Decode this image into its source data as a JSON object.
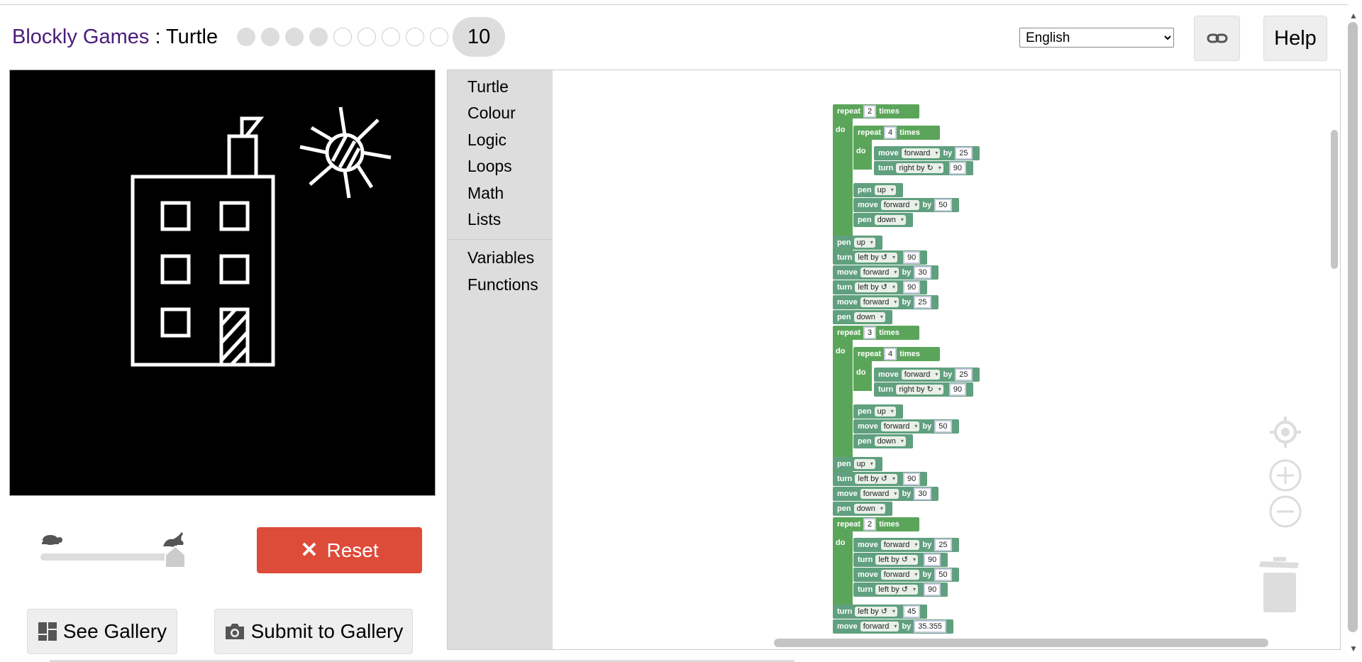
{
  "header": {
    "app_name": "Blockly Games",
    "separator": " : ",
    "game_name": "Turtle",
    "levels_done": 4,
    "levels_total": 9,
    "current_level": "10"
  },
  "language": {
    "selected": "English"
  },
  "buttons": {
    "help": "Help",
    "reset": "Reset",
    "see_gallery": "See Gallery",
    "submit_gallery": "Submit to Gallery"
  },
  "toolbox": {
    "items": [
      "Turtle",
      "Colour",
      "Logic",
      "Loops",
      "Math",
      "Lists"
    ],
    "items2": [
      "Variables",
      "Functions"
    ]
  },
  "speed": {
    "level": 1.0
  },
  "blocks": {
    "repeat": "repeat",
    "times": "times",
    "do": "do",
    "move": "move",
    "by": "by",
    "turn": "turn",
    "pen": "pen",
    "forward": "forward",
    "right_by": "right by ↻",
    "left_by": "left by ↺",
    "up": "up",
    "down": "down",
    "values": {
      "r1": "2",
      "r1a": "4",
      "f25": "25",
      "t90": "90",
      "f50": "50",
      "f30": "30",
      "r2": "3",
      "r3": "2",
      "t45": "45",
      "f35": "35.355"
    }
  },
  "colors": {
    "reset": "#dd4b39",
    "loop_block": "#5ba55b",
    "turtle_block": "#60a07e",
    "title": "#4a1c7a"
  }
}
